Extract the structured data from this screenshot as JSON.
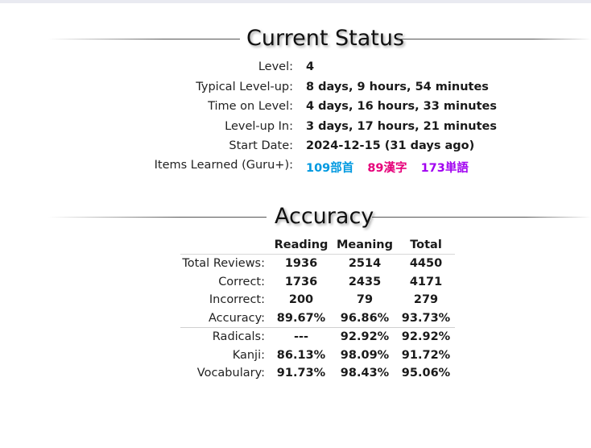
{
  "current_status": {
    "title": "Current Status",
    "rows": [
      {
        "label": "Level:",
        "value": "4"
      },
      {
        "label": "Typical Level-up:",
        "value": "8 days, 9 hours, 54 minutes"
      },
      {
        "label": "Time on Level:",
        "value": "4 days, 16 hours, 33 minutes"
      },
      {
        "label": "Level-up In:",
        "value": "3 days, 17 hours, 21 minutes"
      },
      {
        "label": "Start Date:",
        "value": "2024-12-15 (31 days ago)"
      }
    ],
    "items_learned": {
      "label": "Items Learned (Guru+):",
      "radicals": "109部首",
      "kanji": "89漢字",
      "vocabulary": "173単語"
    }
  },
  "accuracy": {
    "title": "Accuracy",
    "headers": [
      "Reading",
      "Meaning",
      "Total"
    ],
    "rows": [
      {
        "label": "Total Reviews:",
        "reading": "1936",
        "meaning": "2514",
        "total": "4450"
      },
      {
        "label": "Correct:",
        "reading": "1736",
        "meaning": "2435",
        "total": "4171"
      },
      {
        "label": "Incorrect:",
        "reading": "200",
        "meaning": "79",
        "total": "279"
      },
      {
        "label": "Accuracy:",
        "reading": "89.67%",
        "meaning": "96.86%",
        "total": "93.73%"
      },
      {
        "label": "Radicals:",
        "reading": "---",
        "meaning": "92.92%",
        "total": "92.92%"
      },
      {
        "label": "Kanji:",
        "reading": "86.13%",
        "meaning": "98.09%",
        "total": "91.72%"
      },
      {
        "label": "Vocabulary:",
        "reading": "91.73%",
        "meaning": "98.43%",
        "total": "95.06%"
      }
    ]
  },
  "colors": {
    "radical": "#0099e0",
    "kanji": "#e6007a",
    "vocabulary": "#a100f1"
  }
}
